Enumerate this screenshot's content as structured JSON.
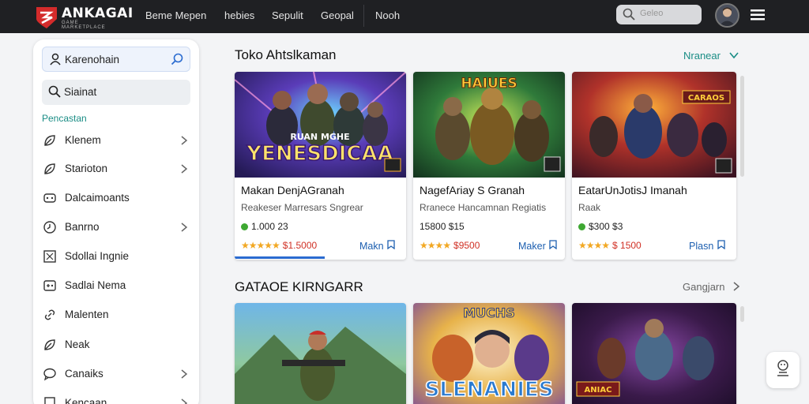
{
  "brand": {
    "name": "ANKAGAI",
    "tagline": "GAME MARKETPLACE"
  },
  "nav": [
    "Beme Mepen",
    "hebies",
    "Sepulit",
    "Geopal",
    "Nooh"
  ],
  "search_top": {
    "placeholder": "Geleo"
  },
  "sidebar": {
    "search_label": "Karenohain",
    "search2_label": "Siainat",
    "section_label": "Pencastan",
    "items": [
      {
        "label": "Klenem",
        "icon": "leaf-icon",
        "chevron": true
      },
      {
        "label": "Starioton",
        "icon": "leaf-icon",
        "chevron": true
      },
      {
        "label": "Dalcaimoants",
        "icon": "gamepad-icon",
        "chevron": false
      },
      {
        "label": "Banrno",
        "icon": "clock-icon",
        "chevron": true
      },
      {
        "label": "Sdollai Ingnie",
        "icon": "puzzle-icon",
        "chevron": false
      },
      {
        "label": "Sadlai Nema",
        "icon": "gamepad-icon",
        "chevron": false
      },
      {
        "label": "Malenten",
        "icon": "link-icon",
        "chevron": false
      },
      {
        "label": "Neak",
        "icon": "leaf-icon",
        "chevron": false
      },
      {
        "label": "Canaiks",
        "icon": "chat-icon",
        "chevron": true
      },
      {
        "label": "Kencaan",
        "icon": "doc-icon",
        "chevron": true
      }
    ]
  },
  "section1": {
    "title": "Toko Ahtslkaman",
    "link": "Nranear",
    "cards": [
      {
        "title": "Makan DenjAGranah",
        "sub": "Reakeser Marresars Sngrear",
        "price": "1.000 23",
        "rating_stars": "★★★★★",
        "rating": "$1.5000",
        "action": "Makn",
        "art_text": "YENESDICAA",
        "art_top": "RUAN MGHE"
      },
      {
        "title": "NagefAriay S Granah",
        "sub": "Rranece Hancamnan Regiatis",
        "price": "15800 $15",
        "rating_stars": "★★★★",
        "rating": "$9500",
        "action": "Maker",
        "art_text": "HAIUES",
        "art_top": ""
      },
      {
        "title": "EatarUnJotisJ Imanah",
        "sub": "Raak",
        "price": "$300 $3",
        "rating_stars": "★★★★",
        "rating": "$ 1500",
        "action": "Plasn",
        "art_text": "CARAOS",
        "art_top": ""
      }
    ]
  },
  "section2": {
    "title": "GATAOE KIRNGARR",
    "link": "Gangjarn",
    "cards": [
      {
        "art_text": ""
      },
      {
        "art_text": "SLENANIES",
        "art_top": "MUCHS"
      },
      {
        "art_text": "ANIAC"
      }
    ]
  },
  "colors": {
    "topbar": "#1f2023",
    "accent": "#2a6bd0",
    "teal": "#1a8d85",
    "price": "#d03024"
  }
}
